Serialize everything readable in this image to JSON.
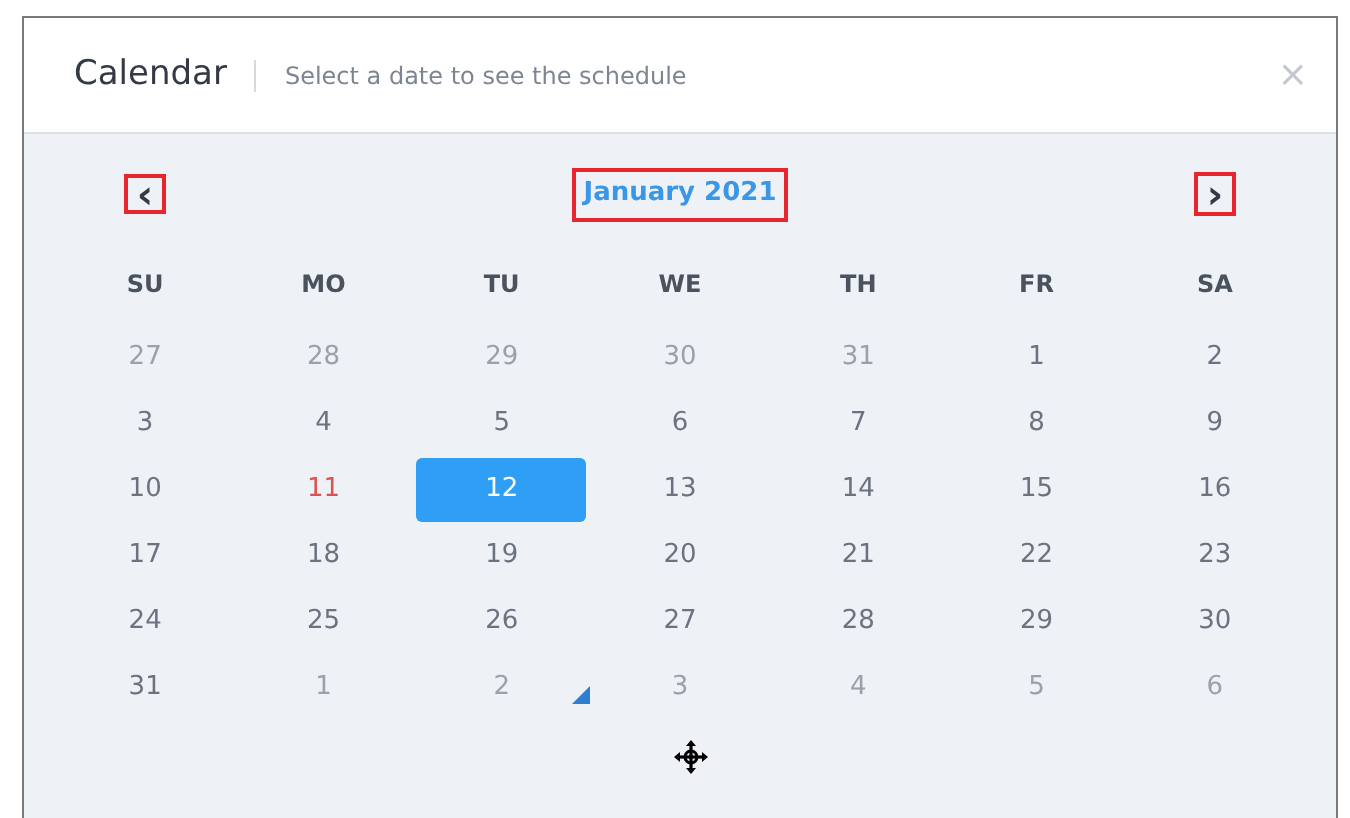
{
  "window": {
    "title": "Calendar",
    "subtitle": "Select a date to see the schedule",
    "close": "×"
  },
  "nav": {
    "prev": "‹",
    "month": "January 2021",
    "next": "›"
  },
  "weekdays": [
    "SU",
    "MO",
    "TU",
    "WE",
    "TH",
    "FR",
    "SA"
  ],
  "days": [
    {
      "label": "27",
      "kind": "other",
      "selected": false
    },
    {
      "label": "28",
      "kind": "other",
      "selected": false
    },
    {
      "label": "29",
      "kind": "other",
      "selected": false
    },
    {
      "label": "30",
      "kind": "other",
      "selected": false
    },
    {
      "label": "31",
      "kind": "other",
      "selected": false
    },
    {
      "label": "1",
      "kind": "day",
      "selected": false
    },
    {
      "label": "2",
      "kind": "day",
      "selected": false
    },
    {
      "label": "3",
      "kind": "day",
      "selected": false
    },
    {
      "label": "4",
      "kind": "day",
      "selected": false
    },
    {
      "label": "5",
      "kind": "day",
      "selected": false
    },
    {
      "label": "6",
      "kind": "day",
      "selected": false
    },
    {
      "label": "7",
      "kind": "day",
      "selected": false
    },
    {
      "label": "8",
      "kind": "day",
      "selected": false
    },
    {
      "label": "9",
      "kind": "day",
      "selected": false
    },
    {
      "label": "10",
      "kind": "day",
      "selected": false
    },
    {
      "label": "11",
      "kind": "holiday",
      "selected": false
    },
    {
      "label": "12",
      "kind": "day",
      "selected": true
    },
    {
      "label": "13",
      "kind": "day",
      "selected": false
    },
    {
      "label": "14",
      "kind": "day",
      "selected": false
    },
    {
      "label": "15",
      "kind": "day",
      "selected": false
    },
    {
      "label": "16",
      "kind": "day",
      "selected": false
    },
    {
      "label": "17",
      "kind": "day",
      "selected": false
    },
    {
      "label": "18",
      "kind": "day",
      "selected": false
    },
    {
      "label": "19",
      "kind": "day",
      "selected": false
    },
    {
      "label": "20",
      "kind": "day",
      "selected": false
    },
    {
      "label": "21",
      "kind": "day",
      "selected": false
    },
    {
      "label": "22",
      "kind": "day",
      "selected": false
    },
    {
      "label": "23",
      "kind": "day",
      "selected": false
    },
    {
      "label": "24",
      "kind": "day",
      "selected": false
    },
    {
      "label": "25",
      "kind": "day",
      "selected": false
    },
    {
      "label": "26",
      "kind": "day",
      "selected": false
    },
    {
      "label": "27",
      "kind": "day",
      "selected": false
    },
    {
      "label": "28",
      "kind": "day",
      "selected": false
    },
    {
      "label": "29",
      "kind": "day",
      "selected": false
    },
    {
      "label": "30",
      "kind": "day",
      "selected": false
    },
    {
      "label": "31",
      "kind": "day",
      "selected": false
    },
    {
      "label": "1",
      "kind": "other",
      "selected": false
    },
    {
      "label": "2",
      "kind": "other",
      "selected": false
    },
    {
      "label": "3",
      "kind": "other",
      "selected": false
    },
    {
      "label": "4",
      "kind": "other",
      "selected": false
    },
    {
      "label": "5",
      "kind": "other",
      "selected": false
    },
    {
      "label": "6",
      "kind": "other",
      "selected": false
    }
  ]
}
